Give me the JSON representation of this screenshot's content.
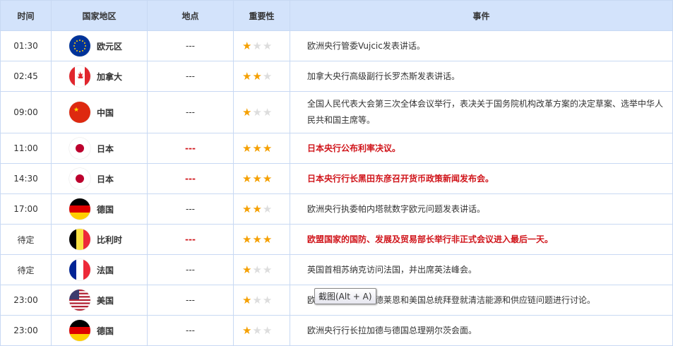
{
  "headers": [
    "时间",
    "国家地区",
    "地点",
    "重要性",
    "事件"
  ],
  "rows": [
    {
      "time": "01:30",
      "country": "欧元区",
      "flag": "eu",
      "place": "---",
      "stars": 1,
      "event": "欧洲央行管委Vujcic发表讲话。",
      "important": false
    },
    {
      "time": "02:45",
      "country": "加拿大",
      "flag": "ca",
      "place": "---",
      "stars": 2,
      "event": "加拿大央行高级副行长罗杰斯发表讲话。",
      "important": false
    },
    {
      "time": "09:00",
      "country": "中国",
      "flag": "cn",
      "place": "---",
      "stars": 1,
      "event": "全国人民代表大会第三次全体会议举行，表决关于国务院机构改革方案的决定草案、选举中华人民共和国主席等。",
      "important": false
    },
    {
      "time": "11:00",
      "country": "日本",
      "flag": "jp",
      "place": "---",
      "stars": 3,
      "event": "日本央行公布利率决议。",
      "important": true
    },
    {
      "time": "14:30",
      "country": "日本",
      "flag": "jp",
      "place": "---",
      "stars": 3,
      "event": "日本央行行长黑田东彦召开货币政策新闻发布会。",
      "important": true
    },
    {
      "time": "17:00",
      "country": "德国",
      "flag": "de",
      "place": "---",
      "stars": 2,
      "event": "欧洲央行执委帕内塔就数字欧元问题发表讲话。",
      "important": false
    },
    {
      "time": "待定",
      "country": "比利时",
      "flag": "be",
      "place": "---",
      "stars": 3,
      "event": "欧盟国家的国防、发展及贸易部长举行非正式会议进入最后一天。",
      "important": true
    },
    {
      "time": "待定",
      "country": "法国",
      "flag": "fr",
      "place": "---",
      "stars": 1,
      "event": "英国首相苏纳克访问法国，并出席英法峰会。",
      "important": false
    },
    {
      "time": "23:00",
      "country": "美国",
      "flag": "us",
      "place": "---",
      "stars": 1,
      "event": "欧盟委员会主席冯德莱恩和美国总统拜登就清洁能源和供应链问题进行讨论。",
      "important": false
    },
    {
      "time": "23:00",
      "country": "德国",
      "flag": "de",
      "place": "---",
      "stars": 1,
      "event": "欧洲央行行长拉加德与德国总理朔尔茨会面。",
      "important": false
    }
  ],
  "tooltip": "截图(Alt + A)",
  "colors": {
    "header_bg": "#d3e3fb",
    "important_text": "#d0141a",
    "star_on": "#f5a000",
    "star_off": "#dddddd"
  }
}
